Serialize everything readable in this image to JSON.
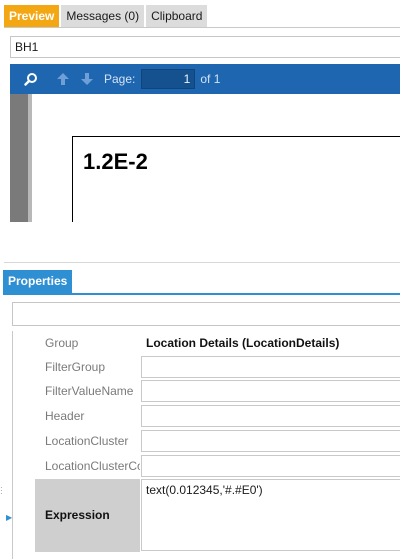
{
  "top_tabs": [
    {
      "label": "Preview",
      "active": true
    },
    {
      "label": "Messages (0)",
      "active": false
    },
    {
      "label": "Clipboard",
      "active": false
    }
  ],
  "report": {
    "name": "BH1"
  },
  "viewer_toolbar": {
    "page_label": "Page:",
    "page_value": "1",
    "page_of": "of 1",
    "icons": [
      "search-icon",
      "arrow-up-icon",
      "arrow-down-icon"
    ]
  },
  "report_canvas": {
    "value_text": "1.2E-2"
  },
  "properties": {
    "tab_label": "Properties",
    "rows": [
      {
        "name": "Group",
        "value": "Location Details (LocationDetails)"
      },
      {
        "name": "FilterGroup",
        "value": ""
      },
      {
        "name": "FilterValueName",
        "value": ""
      },
      {
        "name": "Header",
        "value": ""
      },
      {
        "name": "LocationCluster",
        "value": ""
      },
      {
        "name": "LocationClusterCo",
        "value": ""
      }
    ],
    "expression": {
      "name": "Expression",
      "value": "text(0.012345,'#.#E0')"
    }
  },
  "colors": {
    "active_tab": "#f3a712",
    "toolbar": "#1f66b1",
    "properties_tab": "#2e8fd3"
  }
}
